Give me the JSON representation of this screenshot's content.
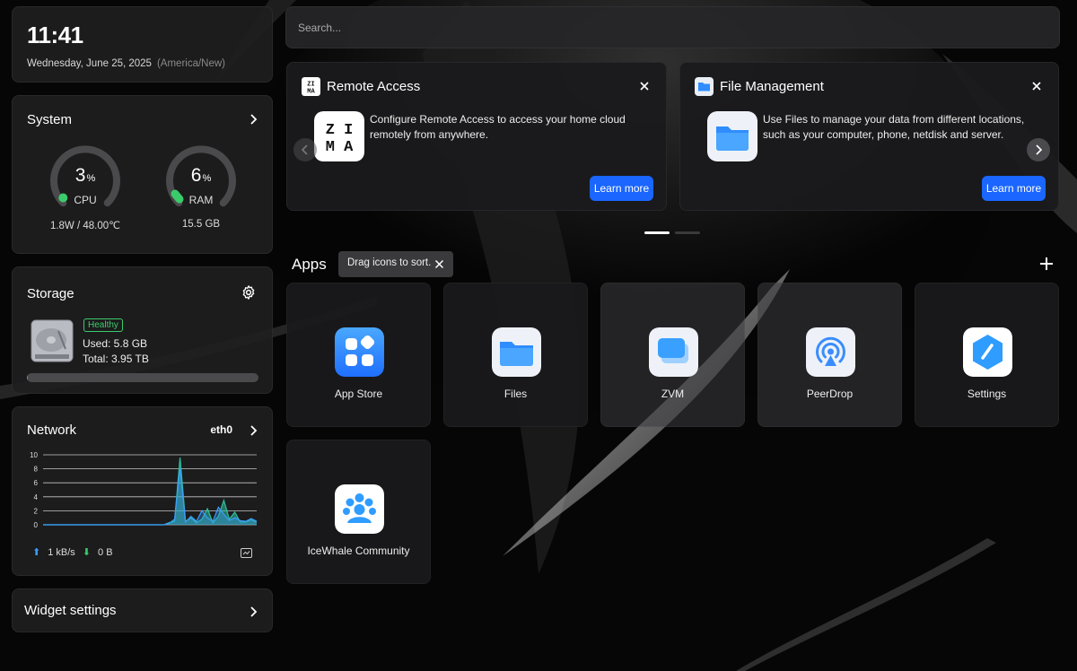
{
  "clock": {
    "time": "11:41",
    "date": "Wednesday, June 25, 2025",
    "timezone": "(America/New)"
  },
  "system": {
    "title": "System",
    "cpu": {
      "value": "3",
      "unit": "%",
      "label": "CPU",
      "sub": "1.8W / 48.00℃",
      "percent": 3
    },
    "ram": {
      "value": "6",
      "unit": "%",
      "label": "RAM",
      "sub": "15.5 GB",
      "percent": 6
    }
  },
  "storage": {
    "title": "Storage",
    "status": "Healthy",
    "used": "Used: 5.8 GB",
    "total": "Total: 3.95 TB",
    "used_fraction": 0.0015
  },
  "network": {
    "title": "Network",
    "interface": "eth0",
    "upload": "1 kB/s",
    "download": "0 B",
    "chart_data": {
      "type": "area",
      "y_ticks": [
        "10",
        "8",
        "6",
        "4",
        "2",
        "0"
      ],
      "ylim": [
        0,
        10
      ],
      "x": [
        0,
        1,
        2,
        3,
        4,
        5,
        6,
        7,
        8,
        9,
        10,
        11,
        12,
        13,
        14,
        15,
        16,
        17,
        18,
        19,
        20,
        21,
        22,
        23,
        24,
        25,
        26,
        27,
        28,
        29,
        30,
        31,
        32,
        33,
        34,
        35,
        36,
        37,
        38,
        39
      ],
      "series": [
        {
          "values": [
            0,
            0,
            0,
            0,
            0,
            0,
            0,
            0,
            0,
            0,
            0,
            0,
            0,
            0,
            0,
            0,
            0,
            0,
            0,
            0,
            0,
            0,
            0,
            0.3,
            0.5,
            9.6,
            0.5,
            1.0,
            0.3,
            0.8,
            2.3,
            0.3,
            1.2,
            3.5,
            0.8,
            1.8,
            0.4,
            0.4,
            0.7,
            0.4
          ]
        },
        {
          "values": [
            0,
            0,
            0,
            0,
            0,
            0,
            0,
            0,
            0,
            0,
            0,
            0,
            0,
            0,
            0,
            0,
            0,
            0,
            0,
            0,
            0,
            0,
            0,
            0.2,
            0.8,
            8.0,
            0.4,
            1.2,
            0.5,
            2.0,
            1.0,
            0.5,
            2.5,
            1.5,
            0.6,
            1.0,
            0.6,
            0.5,
            0.9,
            0.5
          ]
        }
      ]
    }
  },
  "widget": {
    "title": "Widget settings"
  },
  "search": {
    "placeholder": "Search..."
  },
  "promos": [
    {
      "title": "Remote Access",
      "description": "Configure Remote Access to access your home cloud remotely from anywhere.",
      "button": "Learn more"
    },
    {
      "title": "File Management",
      "description": "Use Files to manage your data from different locations, such as your computer, phone, netdisk and server.",
      "button": "Learn more"
    }
  ],
  "apps": {
    "title": "Apps",
    "tooltip": "Drag icons to sort.",
    "items": [
      {
        "name": "App Store"
      },
      {
        "name": "Files"
      },
      {
        "name": "ZVM"
      },
      {
        "name": "PeerDrop"
      },
      {
        "name": "Settings"
      },
      {
        "name": "IceWhale Community"
      }
    ]
  },
  "colors": {
    "accent": "#1a66ff",
    "healthy": "#3ccb6b",
    "gauge": "#3ccb6b",
    "net_up": "#3b9dff",
    "net_down": "#2dbfa0"
  }
}
